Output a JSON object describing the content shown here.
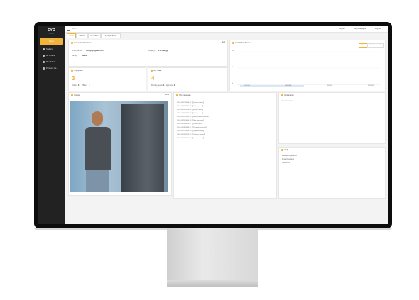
{
  "app": {
    "logo": "EYO",
    "logo_sub": "CLOUD"
  },
  "sidebar": {
    "items": [
      {
        "label": "Home",
        "active": true
      },
      {
        "label": "Stations"
      },
      {
        "label": "My Orders"
      },
      {
        "label": "My Address"
      },
      {
        "label": "Personal Ce..."
      }
    ]
  },
  "topbar": {
    "search_placeholder": "Search",
    "language": "English",
    "messages": "My messages",
    "logout": "Log out"
  },
  "tabs": [
    "Home",
    "Stations",
    "My Orders",
    "My applications"
  ],
  "personal": {
    "title": "Personal Information",
    "edit": "Edit",
    "email_label": "Email address:",
    "email_value": "hello@eyo-global.com",
    "company_label": "Company:",
    "company_value": "ZYC Energy",
    "identity_label": "Identity:",
    "identity_value": "Buyer"
  },
  "system": {
    "title": "My system",
    "count": "3",
    "online_label": "Online:",
    "online_value": "3",
    "offline_label": "Offline:",
    "offline_value": "0"
  },
  "trade": {
    "title": "My Trade",
    "count": "4",
    "pending_label": "Pending review:",
    "pending_value": "4",
    "approved_label": "Approved:",
    "approved_value": "0"
  },
  "chart": {
    "title": "Installation Trends",
    "buttons": [
      "Week",
      "Month",
      "Year"
    ],
    "yticks": [
      "10",
      "5",
      "0"
    ],
    "xticks": [
      "2024-04-01",
      "2024-04-08",
      "2024-04-15",
      "2024-04-22"
    ]
  },
  "photo_card": {
    "title": "Picture",
    "more": "More"
  },
  "messages": {
    "title": "My messages",
    "items": [
      "2024-06-27 09:08:12 【System notice】",
      "2024-06-26 17:51:03 【Order update】",
      "2024-06-25 11:30:44 【Station online】",
      "2024-06-24 15:12:09 【Audit passed】",
      "2024-06-21 10:02:55 【Maintenance reminder】",
      "2024-06-20 14:45:18 【New message】",
      "2024-06-19 09:26:37 【Device alert】",
      "2024-06-18 16:08:21 【Payment received】",
      "2024-06-17 08:54:40 【Shipment sent】",
      "2024-06-15 13:19:02 【Contract signed】",
      "2024-06-14 10:41:16 【Invoice issued】"
    ]
  },
  "documents": {
    "title": "Documents",
    "empty": "No documents"
  },
  "help": {
    "title": "Help",
    "items": [
      "Installation guidance",
      "Product features",
      "Get service"
    ]
  }
}
